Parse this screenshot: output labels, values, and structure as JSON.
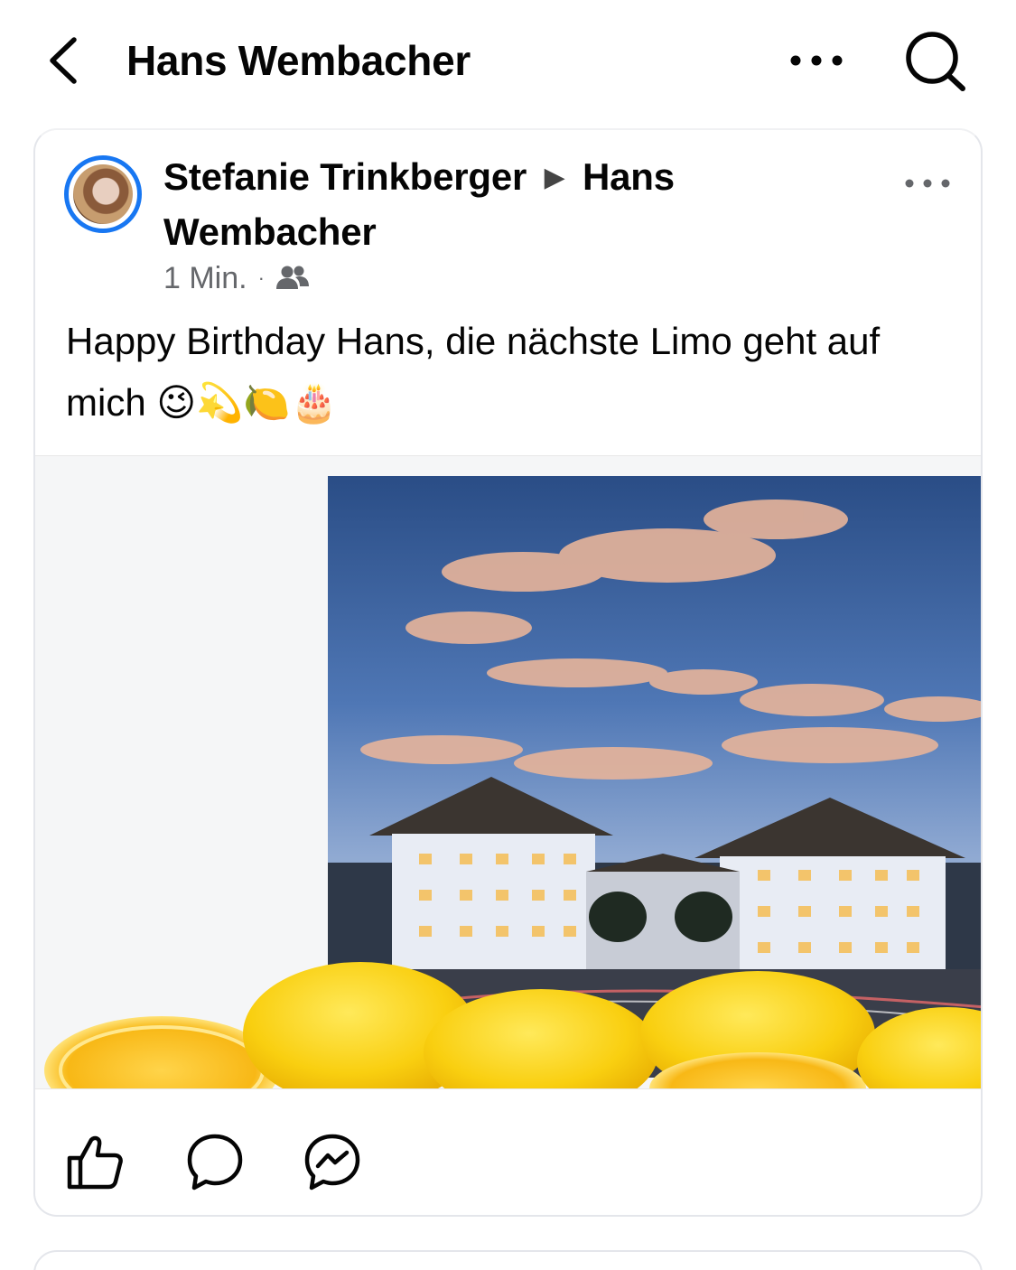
{
  "header": {
    "title": "Hans Wembacher",
    "back_icon": "chevron-left-icon",
    "more_icon": "more-horizontal-icon",
    "search_icon": "search-icon"
  },
  "post": {
    "author": "Stefanie Trinkberger",
    "separator": "▶",
    "target": "Hans Wembacher",
    "timestamp": "1 Min.",
    "meta_dot": "·",
    "audience_icon": "friends-icon",
    "text": "Happy Birthday Hans, die nächste Limo geht auf mich 😉💫🍋🎂",
    "avatar_ring_color": "#1877f2",
    "more_icon": "more-horizontal-icon",
    "actions": {
      "like_icon": "thumbs-up-icon",
      "comment_icon": "comment-icon",
      "share_icon": "messenger-icon"
    }
  },
  "colors": {
    "text_primary": "#050505",
    "text_secondary": "#65676b",
    "card_border": "#e4e6eb",
    "accent": "#1877f2"
  }
}
